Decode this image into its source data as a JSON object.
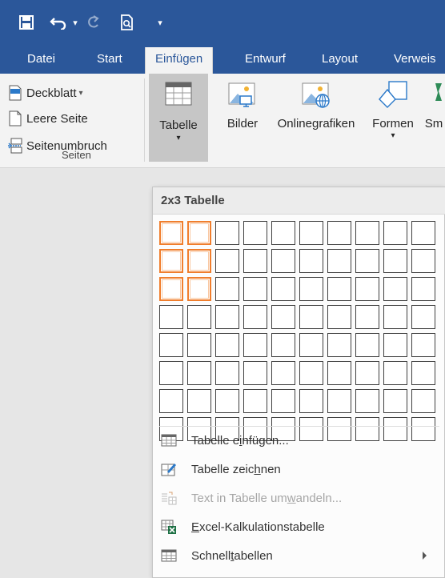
{
  "quick_access": {
    "save_icon": "save-icon",
    "undo_icon": "undo-icon",
    "undo_dropdown": "▾",
    "redo_icon": "redo-icon",
    "print_preview_icon": "print-preview-icon",
    "customize": "▾"
  },
  "tabs": [
    {
      "label": "Datei"
    },
    {
      "label": "Start"
    },
    {
      "label": "Einfügen",
      "active": true
    },
    {
      "label": "Entwurf"
    },
    {
      "label": "Layout"
    },
    {
      "label": "Verweis"
    }
  ],
  "ribbon": {
    "seiten_group": {
      "label": "Seiten",
      "items": [
        {
          "label": "Deckblatt",
          "icon": "cover-page-icon",
          "has_dropdown": true
        },
        {
          "label": "Leere Seite",
          "icon": "blank-page-icon"
        },
        {
          "label": "Seitenumbruch",
          "icon": "page-break-icon"
        }
      ]
    },
    "tabelle_button": {
      "label": "Tabelle",
      "icon": "table-icon"
    },
    "bilder_button": {
      "label": "Bilder",
      "icon": "pictures-icon"
    },
    "onlinegrafiken_button": {
      "label": "Onlinegrafiken",
      "icon": "online-pictures-icon"
    },
    "formen_button": {
      "label": "Formen",
      "icon": "shapes-icon"
    },
    "smartart_button": {
      "label": "Sm"
    },
    "colors": {
      "accent": "#2b579a",
      "selection": "#f07e2d"
    }
  },
  "table_dropdown": {
    "title": "2x3 Tabelle",
    "grid": {
      "columns": 10,
      "rows": 8,
      "selected_columns": 2,
      "selected_rows": 3
    },
    "menu": [
      {
        "pre": "Tabelle e",
        "key": "i",
        "post": "nfügen...",
        "icon": "insert-table-icon",
        "enabled": true
      },
      {
        "pre": "Tabelle zeic",
        "key": "h",
        "post": "nen",
        "icon": "draw-table-icon",
        "enabled": true
      },
      {
        "pre": "Text in Tabelle um",
        "key": "w",
        "post": "andeln...",
        "icon": "convert-text-to-table-icon",
        "enabled": false
      },
      {
        "pre": "",
        "key": "E",
        "post": "xcel-Kalkulationstabelle",
        "icon": "excel-spreadsheet-icon",
        "enabled": true
      },
      {
        "pre": "Schnell",
        "key": "t",
        "post": "abellen",
        "icon": "quick-tables-icon",
        "enabled": true,
        "submenu": true
      }
    ]
  }
}
